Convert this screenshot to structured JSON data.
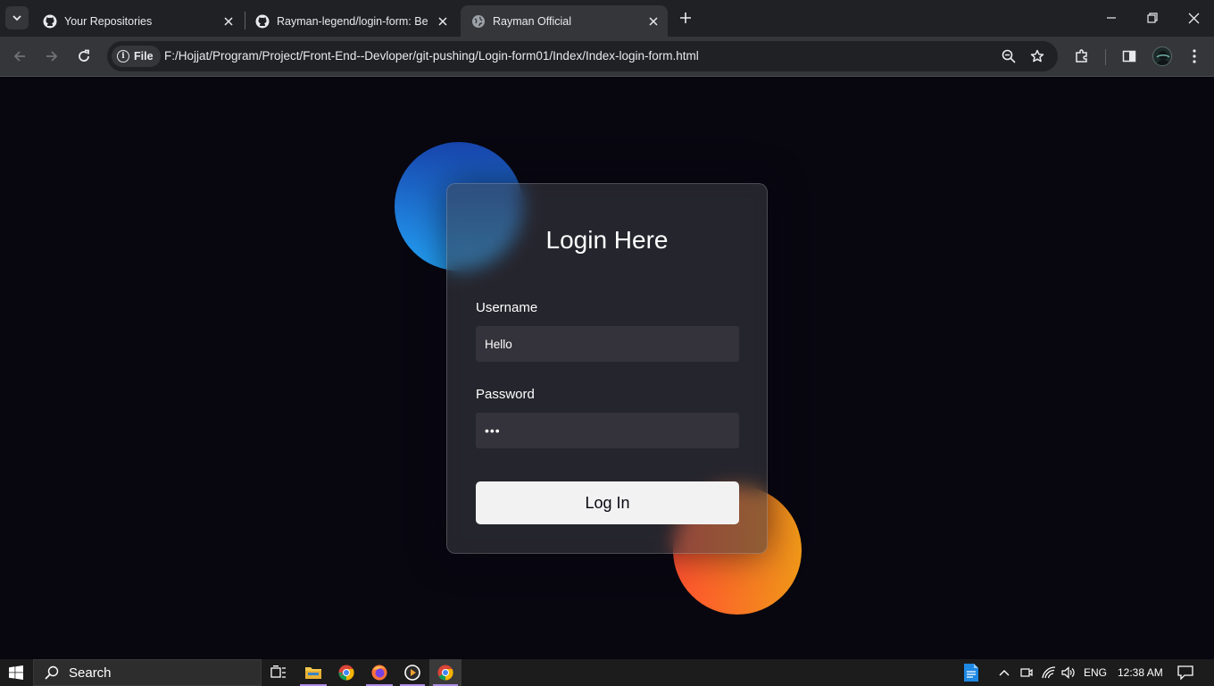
{
  "browser": {
    "tabs": [
      {
        "title": "Your Repositories",
        "icon": "github-icon"
      },
      {
        "title": "Rayman-legend/login-form: Be",
        "icon": "github-icon"
      },
      {
        "title": "Rayman Official",
        "icon": "globe-icon",
        "active": true
      }
    ],
    "site_chip": "File",
    "url": "F:/Hojjat/Program/Project/Front-End--Devloper/git-pushing/Login-form01/Index/Index-login-form.html"
  },
  "login": {
    "title": "Login Here",
    "username_label": "Username",
    "username_value": "Hello",
    "password_label": "Password",
    "password_value": "•••",
    "submit_label": "Log In"
  },
  "colors": {
    "background": "#080710",
    "shape_blue": [
      "#1845ad",
      "#23a2f6"
    ],
    "shape_orange": [
      "#ff512f",
      "#f09819"
    ]
  },
  "taskbar": {
    "search_label": "Search",
    "language": "ENG",
    "time": "12:38 AM"
  }
}
